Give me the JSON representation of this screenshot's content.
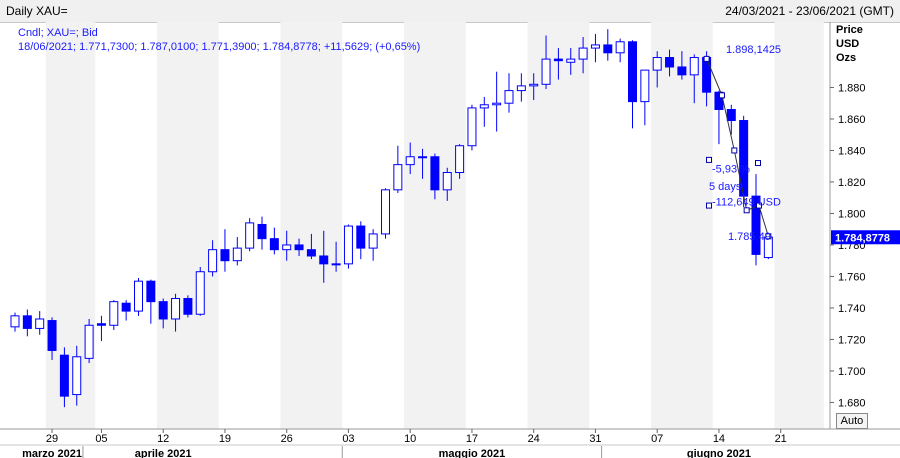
{
  "header": {
    "title": "Daily XAU=",
    "range": "24/03/2021 - 23/06/2021 (GMT)"
  },
  "legend": {
    "line1": "Cndl; XAU=; Bid",
    "line2": "18/06/2021; 1.771,7300; 1.787,0100; 1.771,3900; 1.784,8778; +11,5629; (+0,65%)"
  },
  "price_axis": {
    "header": [
      "Price",
      "USD",
      "Ozs"
    ],
    "current_label": "1.784,8778",
    "auto_label": "Auto"
  },
  "annotations": {
    "peak_label": "1.898,1425",
    "low_label": "1.785,49",
    "pct_label": "-5,93 %",
    "days_label": "5 days",
    "abs_label": "-112,649 USD"
  },
  "colors": {
    "up_fill": "#ffffff",
    "down_fill": "#0000ff",
    "candle_stroke": "#0000ff",
    "band": "#f2f2f2",
    "current_box": "#0000ff"
  },
  "chart_data": {
    "type": "candlestick",
    "ylim": [
      1670,
      1930
    ],
    "yticks": [
      1680,
      1700,
      1720,
      1740,
      1760,
      1780,
      1800,
      1820,
      1840,
      1860,
      1880
    ],
    "ytick_labels": [
      "1.680",
      "1.700",
      "1.720",
      "1.740",
      "1.760",
      "1.780",
      "1.800",
      "1.820",
      "1.840",
      "1.860",
      "1.880"
    ],
    "xtick_labels": [
      {
        "date": "2021-03-29",
        "label": "29"
      },
      {
        "date": "2021-04-05",
        "label": "05"
      },
      {
        "date": "2021-04-12",
        "label": "12"
      },
      {
        "date": "2021-04-19",
        "label": "19"
      },
      {
        "date": "2021-04-26",
        "label": "26"
      },
      {
        "date": "2021-05-03",
        "label": "03"
      },
      {
        "date": "2021-05-10",
        "label": "10"
      },
      {
        "date": "2021-05-17",
        "label": "17"
      },
      {
        "date": "2021-05-24",
        "label": "24"
      },
      {
        "date": "2021-05-31",
        "label": "31"
      },
      {
        "date": "2021-06-07",
        "label": "07"
      },
      {
        "date": "2021-06-14",
        "label": "14"
      },
      {
        "date": "2021-06-21",
        "label": "21"
      }
    ],
    "months": [
      {
        "label": "marzo 2021",
        "date": "2021-03-29"
      },
      {
        "label": "aprile 2021",
        "date": "2021-04-12"
      },
      {
        "label": "maggio 2021",
        "date": "2021-05-17"
      },
      {
        "label": "giugno 2021",
        "date": "2021-06-14"
      }
    ],
    "candles": [
      {
        "date": "2021-03-24",
        "open": 1728,
        "high": 1737,
        "low": 1725,
        "close": 1735
      },
      {
        "date": "2021-03-25",
        "open": 1735,
        "high": 1739,
        "low": 1722,
        "close": 1727
      },
      {
        "date": "2021-03-26",
        "open": 1727,
        "high": 1738,
        "low": 1723,
        "close": 1733
      },
      {
        "date": "2021-03-29",
        "open": 1732,
        "high": 1734,
        "low": 1707,
        "close": 1713
      },
      {
        "date": "2021-03-30",
        "open": 1710,
        "high": 1715,
        "low": 1677,
        "close": 1684
      },
      {
        "date": "2021-03-31",
        "open": 1685,
        "high": 1716,
        "low": 1678,
        "close": 1709
      },
      {
        "date": "2021-04-01",
        "open": 1708,
        "high": 1733,
        "low": 1705,
        "close": 1729
      },
      {
        "date": "2021-04-05",
        "open": 1730,
        "high": 1735,
        "low": 1719,
        "close": 1729
      },
      {
        "date": "2021-04-06",
        "open": 1729,
        "high": 1745,
        "low": 1726,
        "close": 1744
      },
      {
        "date": "2021-04-07",
        "open": 1743,
        "high": 1745,
        "low": 1732,
        "close": 1738
      },
      {
        "date": "2021-04-08",
        "open": 1738,
        "high": 1759,
        "low": 1735,
        "close": 1757
      },
      {
        "date": "2021-04-09",
        "open": 1757,
        "high": 1758,
        "low": 1730,
        "close": 1744
      },
      {
        "date": "2021-04-12",
        "open": 1744,
        "high": 1746,
        "low": 1727,
        "close": 1733
      },
      {
        "date": "2021-04-13",
        "open": 1733,
        "high": 1749,
        "low": 1725,
        "close": 1746
      },
      {
        "date": "2021-04-14",
        "open": 1746,
        "high": 1748,
        "low": 1734,
        "close": 1736
      },
      {
        "date": "2021-04-15",
        "open": 1736,
        "high": 1766,
        "low": 1735,
        "close": 1763
      },
      {
        "date": "2021-04-16",
        "open": 1763,
        "high": 1783,
        "low": 1760,
        "close": 1777
      },
      {
        "date": "2021-04-19",
        "open": 1777,
        "high": 1790,
        "low": 1763,
        "close": 1770
      },
      {
        "date": "2021-04-20",
        "open": 1770,
        "high": 1785,
        "low": 1767,
        "close": 1778
      },
      {
        "date": "2021-04-21",
        "open": 1778,
        "high": 1797,
        "low": 1776,
        "close": 1794
      },
      {
        "date": "2021-04-22",
        "open": 1793,
        "high": 1798,
        "low": 1777,
        "close": 1784
      },
      {
        "date": "2021-04-23",
        "open": 1784,
        "high": 1791,
        "low": 1774,
        "close": 1777
      },
      {
        "date": "2021-04-26",
        "open": 1777,
        "high": 1789,
        "low": 1770,
        "close": 1780
      },
      {
        "date": "2021-04-27",
        "open": 1780,
        "high": 1784,
        "low": 1773,
        "close": 1777
      },
      {
        "date": "2021-04-28",
        "open": 1777,
        "high": 1787,
        "low": 1771,
        "close": 1773
      },
      {
        "date": "2021-04-29",
        "open": 1773,
        "high": 1789,
        "low": 1756,
        "close": 1768
      },
      {
        "date": "2021-04-30",
        "open": 1768,
        "high": 1782,
        "low": 1763,
        "close": 1768
      },
      {
        "date": "2021-05-03",
        "open": 1768,
        "high": 1793,
        "low": 1765,
        "close": 1792
      },
      {
        "date": "2021-05-04",
        "open": 1792,
        "high": 1795,
        "low": 1771,
        "close": 1778
      },
      {
        "date": "2021-05-05",
        "open": 1778,
        "high": 1790,
        "low": 1770,
        "close": 1787
      },
      {
        "date": "2021-05-06",
        "open": 1787,
        "high": 1816,
        "low": 1784,
        "close": 1815
      },
      {
        "date": "2021-05-07",
        "open": 1815,
        "high": 1843,
        "low": 1813,
        "close": 1831
      },
      {
        "date": "2021-05-10",
        "open": 1831,
        "high": 1845,
        "low": 1825,
        "close": 1836
      },
      {
        "date": "2021-05-11",
        "open": 1836,
        "high": 1841,
        "low": 1822,
        "close": 1836
      },
      {
        "date": "2021-05-12",
        "open": 1836,
        "high": 1838,
        "low": 1809,
        "close": 1815
      },
      {
        "date": "2021-05-13",
        "open": 1815,
        "high": 1829,
        "low": 1808,
        "close": 1826
      },
      {
        "date": "2021-05-14",
        "open": 1826,
        "high": 1844,
        "low": 1822,
        "close": 1843
      },
      {
        "date": "2021-05-17",
        "open": 1843,
        "high": 1869,
        "low": 1840,
        "close": 1867
      },
      {
        "date": "2021-05-18",
        "open": 1867,
        "high": 1874,
        "low": 1855,
        "close": 1869
      },
      {
        "date": "2021-05-19",
        "open": 1869,
        "high": 1890,
        "low": 1852,
        "close": 1870
      },
      {
        "date": "2021-05-20",
        "open": 1870,
        "high": 1889,
        "low": 1864,
        "close": 1878
      },
      {
        "date": "2021-05-21",
        "open": 1878,
        "high": 1889,
        "low": 1871,
        "close": 1881
      },
      {
        "date": "2021-05-24",
        "open": 1881,
        "high": 1889,
        "low": 1872,
        "close": 1882
      },
      {
        "date": "2021-05-25",
        "open": 1882,
        "high": 1913,
        "low": 1879,
        "close": 1898
      },
      {
        "date": "2021-05-26",
        "open": 1898,
        "high": 1905,
        "low": 1885,
        "close": 1897
      },
      {
        "date": "2021-05-27",
        "open": 1896,
        "high": 1905,
        "low": 1888,
        "close": 1898
      },
      {
        "date": "2021-05-28",
        "open": 1898,
        "high": 1912,
        "low": 1889,
        "close": 1905
      },
      {
        "date": "2021-05-31",
        "open": 1905,
        "high": 1914,
        "low": 1896,
        "close": 1907
      },
      {
        "date": "2021-06-01",
        "open": 1907,
        "high": 1917,
        "low": 1897,
        "close": 1902
      },
      {
        "date": "2021-06-02",
        "open": 1902,
        "high": 1911,
        "low": 1896,
        "close": 1909
      },
      {
        "date": "2021-06-03",
        "open": 1909,
        "high": 1910,
        "low": 1854,
        "close": 1871
      },
      {
        "date": "2021-06-04",
        "open": 1871,
        "high": 1891,
        "low": 1856,
        "close": 1891
      },
      {
        "date": "2021-06-07",
        "open": 1891,
        "high": 1903,
        "low": 1880,
        "close": 1899
      },
      {
        "date": "2021-06-08",
        "open": 1899,
        "high": 1904,
        "low": 1887,
        "close": 1893
      },
      {
        "date": "2021-06-09",
        "open": 1893,
        "high": 1903,
        "low": 1885,
        "close": 1888
      },
      {
        "date": "2021-06-10",
        "open": 1888,
        "high": 1901,
        "low": 1870,
        "close": 1899
      },
      {
        "date": "2021-06-11",
        "open": 1899,
        "high": 1903,
        "low": 1868,
        "close": 1877
      },
      {
        "date": "2021-06-14",
        "open": 1877,
        "high": 1878,
        "low": 1844,
        "close": 1866
      },
      {
        "date": "2021-06-15",
        "open": 1866,
        "high": 1869,
        "low": 1850,
        "close": 1859
      },
      {
        "date": "2021-06-16",
        "open": 1859,
        "high": 1862,
        "low": 1804,
        "close": 1811
      },
      {
        "date": "2021-06-17",
        "open": 1811,
        "high": 1825,
        "low": 1767,
        "close": 1774
      },
      {
        "date": "2021-06-18",
        "open": 1772,
        "high": 1787,
        "low": 1771,
        "close": 1785
      }
    ]
  }
}
